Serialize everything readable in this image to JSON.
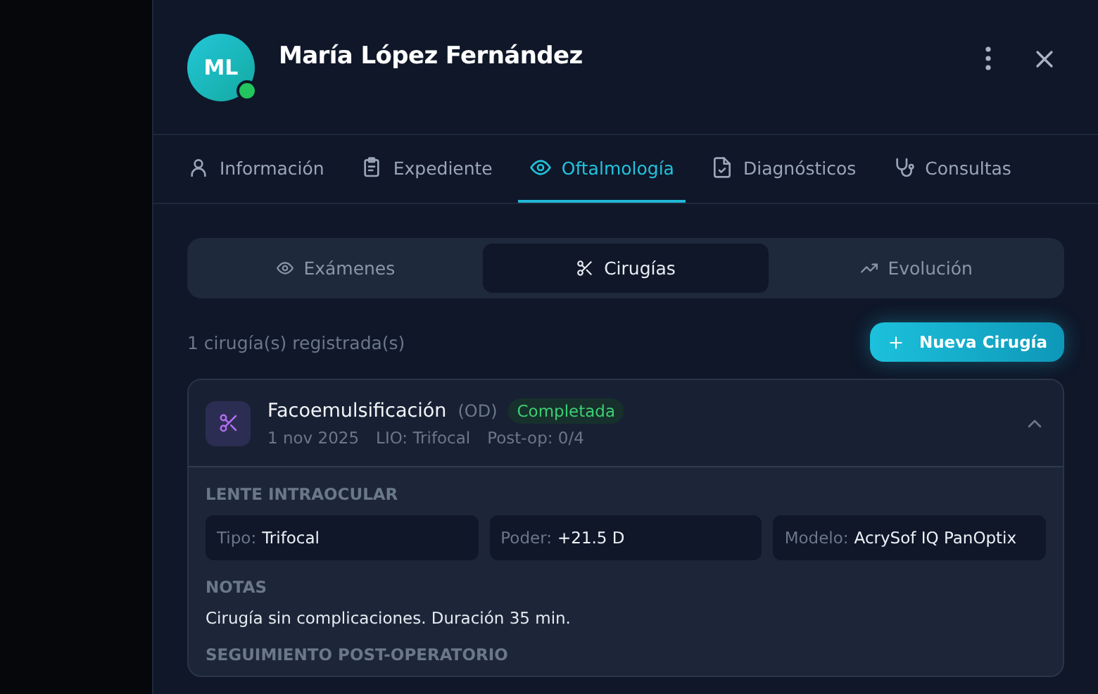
{
  "patient": {
    "initials": "ML",
    "name": "María López Fernández",
    "online": true
  },
  "tabs": [
    {
      "label": "Información",
      "selected": false
    },
    {
      "label": "Expediente",
      "selected": false
    },
    {
      "label": "Oftalmología",
      "selected": true
    },
    {
      "label": "Diagnósticos",
      "selected": false
    },
    {
      "label": "Consultas",
      "selected": false
    }
  ],
  "subtabs": [
    {
      "label": "Exámenes",
      "selected": false
    },
    {
      "label": "Cirugías",
      "selected": true
    },
    {
      "label": "Evolución",
      "selected": false
    }
  ],
  "count": "1 cirugía(s) registrada(s)",
  "add_button": "Nueva Cirugía",
  "surgery": {
    "name": "Facoemulsificación",
    "eye": "(OD)",
    "status": "Completada",
    "date": "1 nov 2025",
    "lio": "LIO: Trifocal",
    "postop": "Post-op: 0/4",
    "expanded": true,
    "lens_heading": "LENTE INTRAOCULAR",
    "lens": [
      {
        "label": "Tipo:",
        "value": "Trifocal"
      },
      {
        "label": "Poder:",
        "value": "+21.5 D"
      },
      {
        "label": "Modelo:",
        "value": "AcrySof IQ PanOptix"
      }
    ],
    "notes_heading": "NOTAS",
    "notes": "Cirugía sin complicaciones. Duración 35 min.",
    "followup_heading": "SEGUIMIENTO POST-OPERATORIO"
  }
}
